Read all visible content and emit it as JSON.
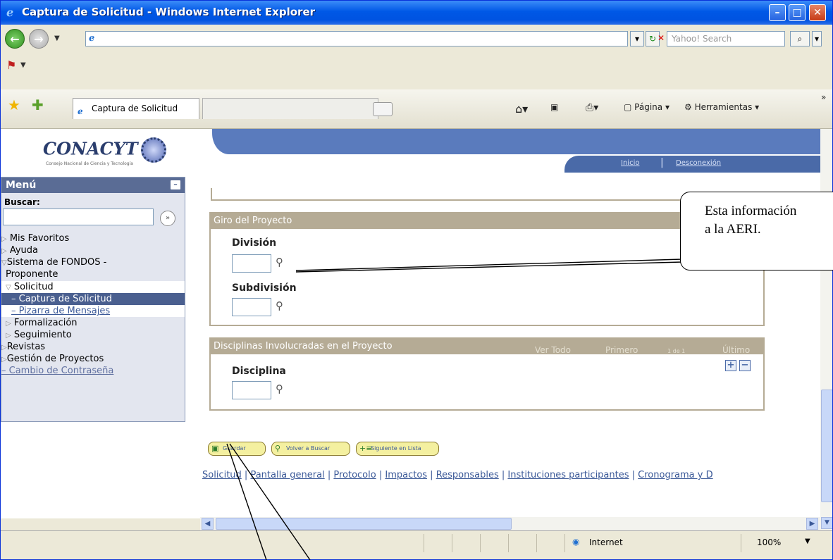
{
  "window": {
    "title": "Captura de Solicitud - Windows Internet Explorer",
    "search_placeholder": "Yahoo! Search",
    "tab_title": "Captura de Solicitud",
    "toolbar": {
      "page_label": "Página",
      "tools_label": "Herramientas",
      "chevron": "»"
    },
    "status": {
      "zone": "Internet",
      "zoom": "100%"
    }
  },
  "page": {
    "logo_text": "CONACYT",
    "logo_subtitle": "Consejo Nacional de Ciencia y Tecnología",
    "banner_links": [
      "Inicio",
      "Desconexión"
    ],
    "menu": {
      "title": "Menú",
      "search_label": "Buscar:",
      "items": [
        {
          "label": "Mis Favoritos"
        },
        {
          "label": "Ayuda"
        },
        {
          "label": "Sistema de FONDOS -"
        },
        {
          "label": "Proponente"
        },
        {
          "label": "Solicitud"
        },
        {
          "label": "– Captura de Solicitud"
        },
        {
          "label": "– Pizarra de Mensajes"
        },
        {
          "label": "Formalización"
        },
        {
          "label": "Seguimiento"
        },
        {
          "label": "Revistas"
        },
        {
          "label": "Gestión de Proyectos"
        },
        {
          "label": "– Cambio de Contraseña"
        }
      ]
    },
    "giro": {
      "header": "Giro del Proyecto",
      "division_label": "División",
      "subdivision_label": "Subdivisión"
    },
    "disciplinas": {
      "header": "Disciplinas Involucradas en el Proyecto",
      "ver_todo": "Ver Todo",
      "primero": "Primero",
      "count": "1 de 1",
      "ultimo": "Último",
      "disciplina_label": "Disciplina"
    },
    "buttons": {
      "save": "Guardar",
      "back": "Volver a Buscar",
      "next": "Siguiente en Lista"
    },
    "bottom_links": [
      "Solicitud",
      "Pantalla general",
      "Protocolo",
      "Impactos",
      "Responsables",
      "Instituciones participantes",
      "Cronograma y D"
    ]
  },
  "callout": {
    "line1": "Esta información",
    "line2": "a la AERI."
  }
}
